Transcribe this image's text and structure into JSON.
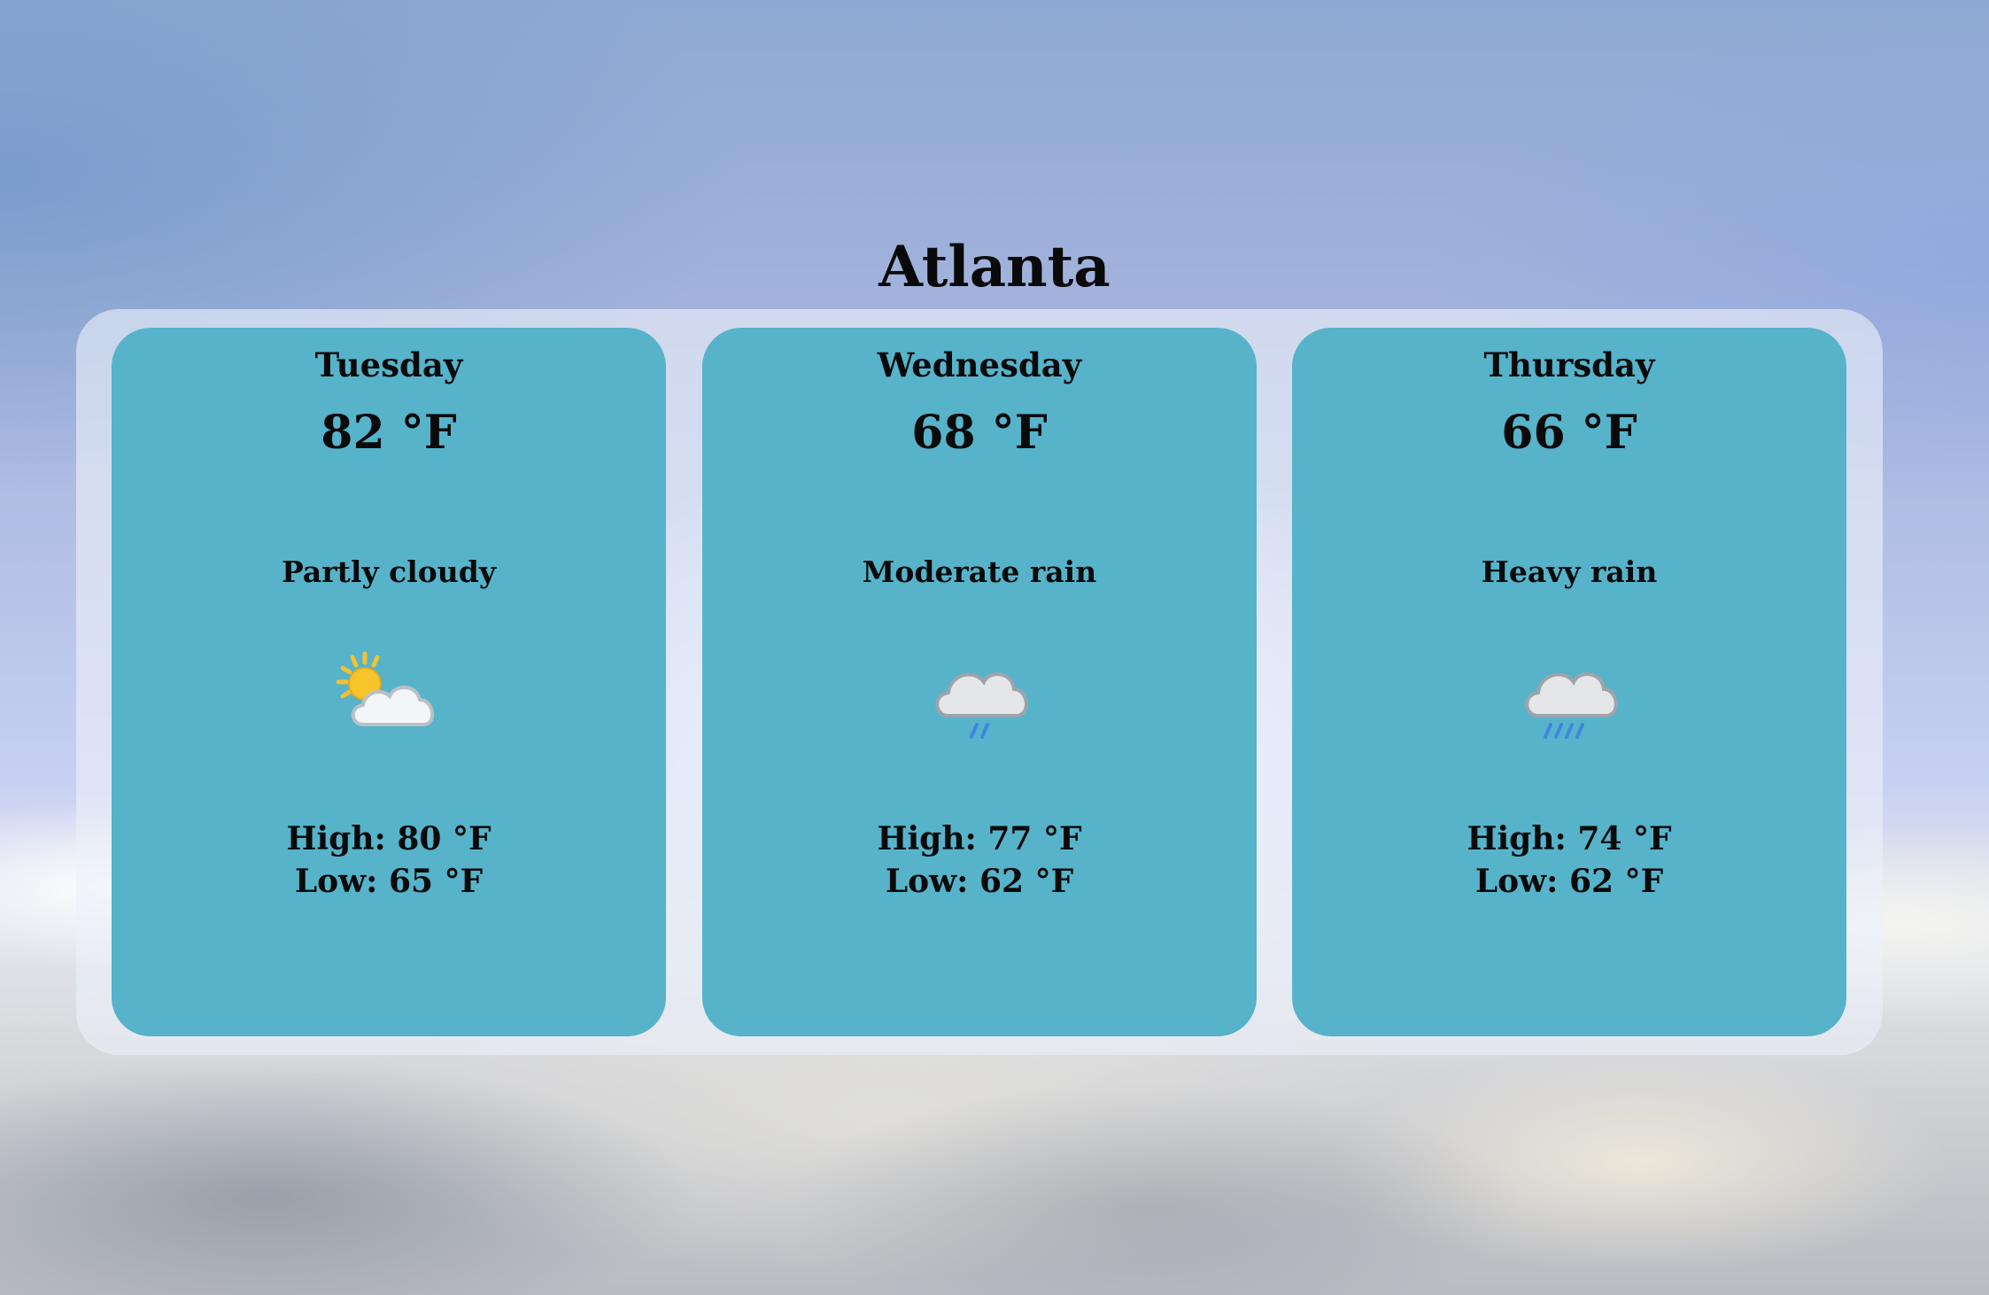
{
  "city": "Atlanta",
  "days": [
    {
      "day": "Tuesday",
      "temp": "82 °F",
      "condition": "Partly cloudy",
      "icon": "partly-cloudy-icon",
      "high": "High: 80 °F",
      "low": "Low: 65 °F"
    },
    {
      "day": "Wednesday",
      "temp": "68 °F",
      "condition": "Moderate rain",
      "icon": "moderate-rain-icon",
      "high": "High: 77 °F",
      "low": "Low: 62 °F"
    },
    {
      "day": "Thursday",
      "temp": "66 °F",
      "condition": "Heavy rain",
      "icon": "heavy-rain-icon",
      "high": "High: 74 °F",
      "low": "Low: 62 °F"
    }
  ],
  "colors": {
    "card": "#56b3ca",
    "panel": "#ebf0f8",
    "text": "#0a0a0a"
  }
}
